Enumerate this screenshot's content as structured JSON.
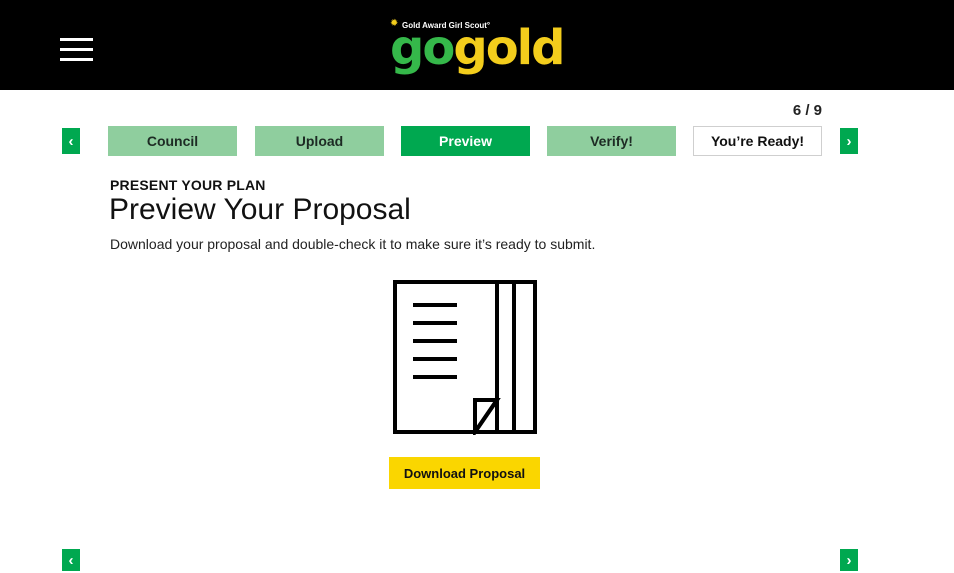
{
  "header": {
    "menu_icon": "hamburger-menu-icon",
    "logo": {
      "tagline": "Gold Award Girl Scout°",
      "word_go": "go",
      "word_gold": "gold",
      "colors": {
        "go": "#35b84a",
        "gold": "#f3cd1c"
      }
    }
  },
  "progress": {
    "step_count": "6 / 9",
    "steps": [
      {
        "label": "Council",
        "state": "done"
      },
      {
        "label": "Upload",
        "state": "done"
      },
      {
        "label": "Preview",
        "state": "current"
      },
      {
        "label": "Verify!",
        "state": "done"
      },
      {
        "label": "You’re Ready!",
        "state": "upcoming"
      }
    ],
    "prev_icon": "chevron-left-icon",
    "next_icon": "chevron-right-icon"
  },
  "content": {
    "kicker": "PRESENT YOUR PLAN",
    "title": "Preview Your Proposal",
    "description": "Download your proposal and double-check it to make sure it’s ready to submit.",
    "illustration_icon": "document-icon",
    "download_label": "Download Proposal"
  },
  "colors": {
    "accent_green": "#00a850",
    "light_green": "#8fce9e",
    "button_yellow": "#fad600",
    "header_black": "#000000"
  },
  "glyphs": {
    "left": "‹",
    "right": "›",
    "sun": "✹"
  }
}
